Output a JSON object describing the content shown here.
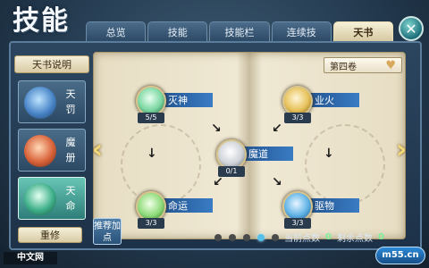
{
  "title": "技能",
  "tabs": [
    {
      "label": "总览",
      "active": false
    },
    {
      "label": "技能",
      "active": false
    },
    {
      "label": "技能栏",
      "active": false
    },
    {
      "label": "连续技",
      "active": false
    },
    {
      "label": "天书",
      "active": true
    }
  ],
  "close_icon": "close-icon",
  "sidebar": {
    "header_label": "天书说明",
    "books": [
      {
        "label": "天罚",
        "color": "#4a86c8",
        "active": false
      },
      {
        "label": "魔册",
        "color": "#d9633a",
        "active": false
      },
      {
        "label": "天命",
        "color": "#3fb08a",
        "active": true
      }
    ],
    "reset_label": "重修"
  },
  "volume": {
    "label": "第四卷",
    "icon": "heart-icon"
  },
  "skills": [
    {
      "name": "灭神",
      "level": "5/5",
      "color": "#7ad7a0"
    },
    {
      "name": "业火",
      "level": "3/3",
      "color": "#e7c25a"
    },
    {
      "name": "魔道",
      "level": "0/1",
      "color": "#cfd3d8"
    },
    {
      "name": "命运",
      "level": "3/3",
      "color": "#8fdb7a"
    },
    {
      "name": "驱物",
      "level": "3/3",
      "color": "#5fb2e6"
    }
  ],
  "recommend_label": "推荐加点",
  "pager": {
    "count": 5,
    "active_index": 3
  },
  "points": {
    "current_label": "当前点数",
    "current_value": "0",
    "remaining_label": "剩余点数",
    "remaining_value": "0"
  },
  "watermark_left": "中文网",
  "watermark_right": "m55.cn",
  "colors": {
    "accent": "#56c0e8",
    "gold": "#f3d87a",
    "skill_bar": "#1f4f8a"
  }
}
